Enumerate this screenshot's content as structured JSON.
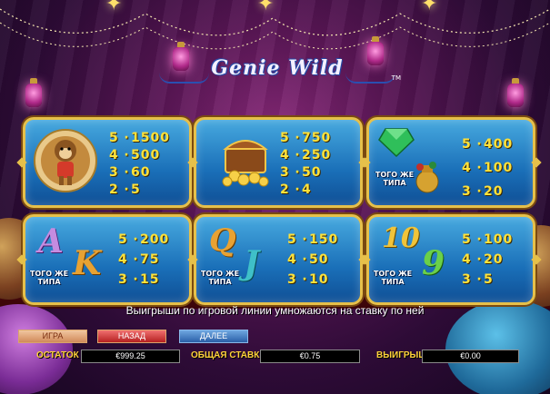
{
  "logo": {
    "title": "Genie Wild",
    "tm": "TM"
  },
  "paytable": [
    {
      "id": "monkey",
      "icon": "monkey-symbol",
      "pays": [
        {
          "count": "5",
          "value": "1500"
        },
        {
          "count": "4",
          "value": "500"
        },
        {
          "count": "3",
          "value": "60"
        },
        {
          "count": "2",
          "value": "5"
        }
      ]
    },
    {
      "id": "treasure",
      "icon": "treasure-chest-symbol",
      "pays": [
        {
          "count": "5",
          "value": "750"
        },
        {
          "count": "4",
          "value": "250"
        },
        {
          "count": "3",
          "value": "50"
        },
        {
          "count": "2",
          "value": "4"
        }
      ]
    },
    {
      "id": "gem-urn",
      "icon": "emerald-and-urn-symbols",
      "same_type": "ТОГО ЖЕ ТИПА",
      "pays": [
        {
          "count": "5",
          "value": "400"
        },
        {
          "count": "4",
          "value": "100"
        },
        {
          "count": "3",
          "value": "20"
        }
      ]
    },
    {
      "id": "ak",
      "icon": "letters-a-k-symbols",
      "letters": [
        "A",
        "K"
      ],
      "same_type": "ТОГО ЖЕ ТИПА",
      "pays": [
        {
          "count": "5",
          "value": "200"
        },
        {
          "count": "4",
          "value": "75"
        },
        {
          "count": "3",
          "value": "15"
        }
      ]
    },
    {
      "id": "qj",
      "icon": "letters-q-j-symbols",
      "letters": [
        "Q",
        "J"
      ],
      "same_type": "ТОГО ЖЕ ТИПА",
      "pays": [
        {
          "count": "5",
          "value": "150"
        },
        {
          "count": "4",
          "value": "50"
        },
        {
          "count": "3",
          "value": "10"
        }
      ]
    },
    {
      "id": "ten-nine",
      "icon": "numbers-10-9-symbols",
      "letters": [
        "10",
        "9"
      ],
      "same_type": "ТОГО ЖЕ ТИПА",
      "pays": [
        {
          "count": "5",
          "value": "100"
        },
        {
          "count": "4",
          "value": "20"
        },
        {
          "count": "3",
          "value": "5"
        }
      ]
    }
  ],
  "info_line": "Выигрыши по игровой линии умножаются на ставку по ней",
  "buttons": {
    "game": "ИГРА",
    "back": "НАЗАД",
    "next": "ДАЛЕЕ"
  },
  "status": {
    "balance_label": "ОСТАТОК",
    "balance_value": "€999.25",
    "bet_label": "ОБЩАЯ СТАВКА",
    "bet_value": "€0.75",
    "win_label": "ВЫИГРЫШ",
    "win_value": "€0.00"
  },
  "colors": {
    "panel_border": "#e6c04a",
    "panel_fill": "#1a6fb8",
    "pay_text": "#ffe23a",
    "status_label": "#ffd23a"
  }
}
